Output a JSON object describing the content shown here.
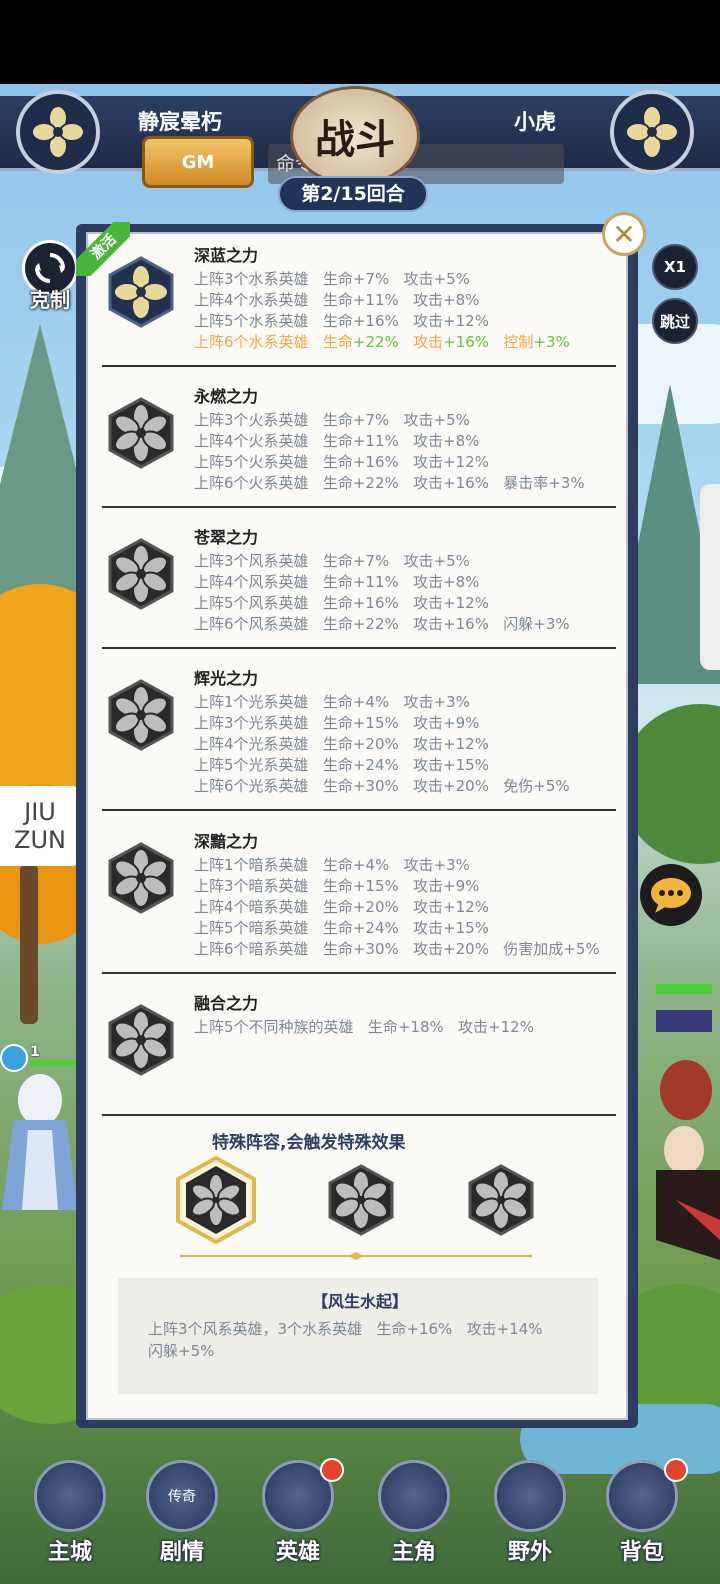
{
  "header": {
    "player_left": "静宸晕朽",
    "player_right": "小虎",
    "gm_button": "GM",
    "battle_badge": "战斗",
    "command_placeholder": "命令",
    "round": "第2/15回合"
  },
  "side": {
    "restrain_label": "克制",
    "speed_button": "X1",
    "skip_button": "跳过",
    "jiuzun_line1": "JIU",
    "jiuzun_line2": "ZUN",
    "left_hero_level": "1"
  },
  "panel": {
    "activated_ribbon": "激活",
    "bonds": [
      {
        "title": "深蓝之力",
        "lines": [
          "上阵3个水系英雄   生命+7%   攻击+5%",
          "上阵4个水系英雄   生命+11%   攻击+8%",
          "上阵5个水系英雄   生命+16%   攻击+12%"
        ],
        "active_line": {
          "a": "上阵6个水系英雄",
          "b": "生命",
          "b2": "+22%",
          "c": "攻击",
          "c2": "+16%",
          "d": "控制",
          "d2": "+3%"
        }
      },
      {
        "title": "永燃之力",
        "lines": [
          "上阵3个火系英雄   生命+7%   攻击+5%",
          "上阵4个火系英雄   生命+11%   攻击+8%",
          "上阵5个火系英雄   生命+16%   攻击+12%",
          "上阵6个火系英雄   生命+22%   攻击+16%   暴击率+3%"
        ]
      },
      {
        "title": "苍翠之力",
        "lines": [
          "上阵3个风系英雄   生命+7%   攻击+5%",
          "上阵4个风系英雄   生命+11%   攻击+8%",
          "上阵5个风系英雄   生命+16%   攻击+12%",
          "上阵6个风系英雄   生命+22%   攻击+16%   闪躲+3%"
        ]
      },
      {
        "title": "辉光之力",
        "lines": [
          "上阵1个光系英雄   生命+4%   攻击+3%",
          "上阵3个光系英雄   生命+15%   攻击+9%",
          "上阵4个光系英雄   生命+20%   攻击+12%",
          "上阵5个光系英雄   生命+24%   攻击+15%",
          "上阵6个光系英雄   生命+30%   攻击+20%   免伤+5%"
        ]
      },
      {
        "title": "深黯之力",
        "lines": [
          "上阵1个暗系英雄   生命+4%   攻击+3%",
          "上阵3个暗系英雄   生命+15%   攻击+9%",
          "上阵4个暗系英雄   生命+20%   攻击+12%",
          "上阵5个暗系英雄   生命+24%   攻击+15%",
          "上阵6个暗系英雄   生命+30%   攻击+20%   伤害加成+5%"
        ]
      },
      {
        "title": "融合之力",
        "lines": [
          "上阵5个不同种族的英雄   生命+18%   攻击+12%"
        ]
      }
    ],
    "special_title": "特殊阵容,会触发特殊效果",
    "special_name": "【风生水起】",
    "special_desc_line1": "上阵3个风系英雄，3个水系英雄   生命+16%   攻击+14%",
    "special_desc_line2": "闪躲+5%"
  },
  "nav": [
    {
      "label": "主城"
    },
    {
      "label": "剧情",
      "icon_text": "传奇"
    },
    {
      "label": "英雄"
    },
    {
      "label": "主角"
    },
    {
      "label": "野外"
    },
    {
      "label": "背包"
    }
  ],
  "colors": {
    "panel_frame": "#2c3c5e",
    "inactive_text": "#7d8896",
    "active_text": "#f0a64a",
    "active_bonus": "#6bbf3a",
    "gold": "#c9a65a"
  }
}
